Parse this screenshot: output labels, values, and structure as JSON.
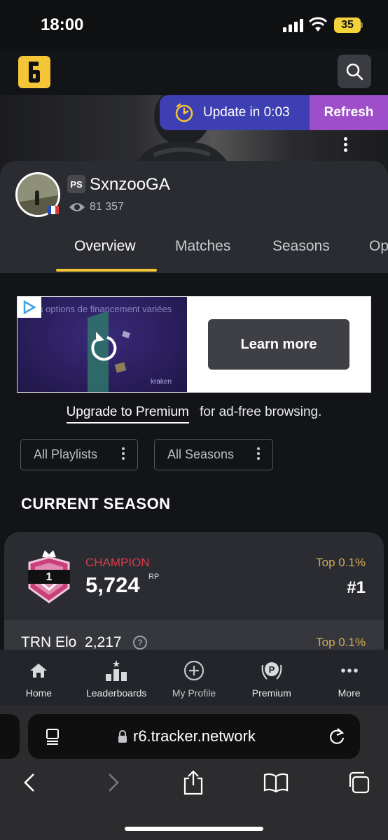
{
  "status_bar": {
    "time": "18:00",
    "battery": "35"
  },
  "header": {
    "logo_glyph": "6",
    "search_icon": "search-icon"
  },
  "banner": {
    "update_text": "Update in 0:03",
    "refresh_label": "Refresh"
  },
  "profile": {
    "username": "SxnzooGA",
    "platform": "PS",
    "views": "81 357",
    "tabs": [
      "Overview",
      "Matches",
      "Seasons",
      "Op"
    ],
    "active_tab": "Overview"
  },
  "ad": {
    "caption": "s options de financement variées",
    "brand": "kraken",
    "cta": "Learn more"
  },
  "premium": {
    "link": "Upgrade to Premium",
    "suffix": "for ad-free browsing."
  },
  "filters": {
    "playlists": "All Playlists",
    "seasons": "All Seasons"
  },
  "current_season": {
    "title": "CURRENT SEASON",
    "rank_badge": "1",
    "rank_name": "CHAMPION",
    "rank_value": "5,724",
    "rank_unit": "RP",
    "top_percent": "Top 0.1%",
    "position": "#1",
    "elo_label": "TRN Elo",
    "elo_value": "2,217",
    "elo_help": "?",
    "elo_top_percent": "Top 0.1%"
  },
  "bottom_nav": [
    {
      "label": "Home",
      "icon": "home-icon"
    },
    {
      "label": "Leaderboards",
      "icon": "leaderboard-icon"
    },
    {
      "label": "My Profile",
      "icon": "plus-circle-icon"
    },
    {
      "label": "Premium",
      "icon": "premium-icon"
    },
    {
      "label": "More",
      "icon": "more-icon"
    }
  ],
  "browser": {
    "url": "r6.tracker.network"
  },
  "colors": {
    "accent": "#f4c637",
    "champion": "#d63c4f",
    "gold": "#d3aa58",
    "update": "#3d3fb3",
    "refresh": "#9d4ec8"
  }
}
